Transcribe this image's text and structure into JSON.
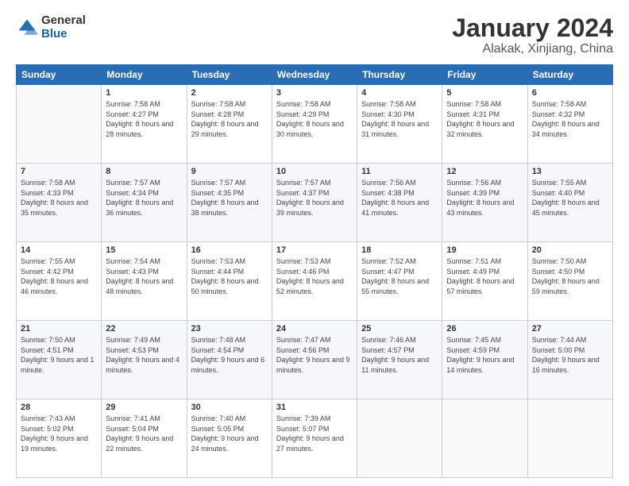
{
  "logo": {
    "general": "General",
    "blue": "Blue"
  },
  "title": "January 2024",
  "location": "Alakak, Xinjiang, China",
  "days_of_week": [
    "Sunday",
    "Monday",
    "Tuesday",
    "Wednesday",
    "Thursday",
    "Friday",
    "Saturday"
  ],
  "weeks": [
    [
      {
        "day": "",
        "sunrise": "",
        "sunset": "",
        "daylight": ""
      },
      {
        "day": "1",
        "sunrise": "Sunrise: 7:58 AM",
        "sunset": "Sunset: 4:27 PM",
        "daylight": "Daylight: 8 hours and 28 minutes."
      },
      {
        "day": "2",
        "sunrise": "Sunrise: 7:58 AM",
        "sunset": "Sunset: 4:28 PM",
        "daylight": "Daylight: 8 hours and 29 minutes."
      },
      {
        "day": "3",
        "sunrise": "Sunrise: 7:58 AM",
        "sunset": "Sunset: 4:29 PM",
        "daylight": "Daylight: 8 hours and 30 minutes."
      },
      {
        "day": "4",
        "sunrise": "Sunrise: 7:58 AM",
        "sunset": "Sunset: 4:30 PM",
        "daylight": "Daylight: 8 hours and 31 minutes."
      },
      {
        "day": "5",
        "sunrise": "Sunrise: 7:58 AM",
        "sunset": "Sunset: 4:31 PM",
        "daylight": "Daylight: 8 hours and 32 minutes."
      },
      {
        "day": "6",
        "sunrise": "Sunrise: 7:58 AM",
        "sunset": "Sunset: 4:32 PM",
        "daylight": "Daylight: 8 hours and 34 minutes."
      }
    ],
    [
      {
        "day": "7",
        "sunrise": "Sunrise: 7:58 AM",
        "sunset": "Sunset: 4:33 PM",
        "daylight": "Daylight: 8 hours and 35 minutes."
      },
      {
        "day": "8",
        "sunrise": "Sunrise: 7:57 AM",
        "sunset": "Sunset: 4:34 PM",
        "daylight": "Daylight: 8 hours and 36 minutes."
      },
      {
        "day": "9",
        "sunrise": "Sunrise: 7:57 AM",
        "sunset": "Sunset: 4:35 PM",
        "daylight": "Daylight: 8 hours and 38 minutes."
      },
      {
        "day": "10",
        "sunrise": "Sunrise: 7:57 AM",
        "sunset": "Sunset: 4:37 PM",
        "daylight": "Daylight: 8 hours and 39 minutes."
      },
      {
        "day": "11",
        "sunrise": "Sunrise: 7:56 AM",
        "sunset": "Sunset: 4:38 PM",
        "daylight": "Daylight: 8 hours and 41 minutes."
      },
      {
        "day": "12",
        "sunrise": "Sunrise: 7:56 AM",
        "sunset": "Sunset: 4:39 PM",
        "daylight": "Daylight: 8 hours and 43 minutes."
      },
      {
        "day": "13",
        "sunrise": "Sunrise: 7:55 AM",
        "sunset": "Sunset: 4:40 PM",
        "daylight": "Daylight: 8 hours and 45 minutes."
      }
    ],
    [
      {
        "day": "14",
        "sunrise": "Sunrise: 7:55 AM",
        "sunset": "Sunset: 4:42 PM",
        "daylight": "Daylight: 8 hours and 46 minutes."
      },
      {
        "day": "15",
        "sunrise": "Sunrise: 7:54 AM",
        "sunset": "Sunset: 4:43 PM",
        "daylight": "Daylight: 8 hours and 48 minutes."
      },
      {
        "day": "16",
        "sunrise": "Sunrise: 7:53 AM",
        "sunset": "Sunset: 4:44 PM",
        "daylight": "Daylight: 8 hours and 50 minutes."
      },
      {
        "day": "17",
        "sunrise": "Sunrise: 7:53 AM",
        "sunset": "Sunset: 4:46 PM",
        "daylight": "Daylight: 8 hours and 52 minutes."
      },
      {
        "day": "18",
        "sunrise": "Sunrise: 7:52 AM",
        "sunset": "Sunset: 4:47 PM",
        "daylight": "Daylight: 8 hours and 55 minutes."
      },
      {
        "day": "19",
        "sunrise": "Sunrise: 7:51 AM",
        "sunset": "Sunset: 4:49 PM",
        "daylight": "Daylight: 8 hours and 57 minutes."
      },
      {
        "day": "20",
        "sunrise": "Sunrise: 7:50 AM",
        "sunset": "Sunset: 4:50 PM",
        "daylight": "Daylight: 8 hours and 59 minutes."
      }
    ],
    [
      {
        "day": "21",
        "sunrise": "Sunrise: 7:50 AM",
        "sunset": "Sunset: 4:51 PM",
        "daylight": "Daylight: 9 hours and 1 minute."
      },
      {
        "day": "22",
        "sunrise": "Sunrise: 7:49 AM",
        "sunset": "Sunset: 4:53 PM",
        "daylight": "Daylight: 9 hours and 4 minutes."
      },
      {
        "day": "23",
        "sunrise": "Sunrise: 7:48 AM",
        "sunset": "Sunset: 4:54 PM",
        "daylight": "Daylight: 9 hours and 6 minutes."
      },
      {
        "day": "24",
        "sunrise": "Sunrise: 7:47 AM",
        "sunset": "Sunset: 4:56 PM",
        "daylight": "Daylight: 9 hours and 9 minutes."
      },
      {
        "day": "25",
        "sunrise": "Sunrise: 7:46 AM",
        "sunset": "Sunset: 4:57 PM",
        "daylight": "Daylight: 9 hours and 11 minutes."
      },
      {
        "day": "26",
        "sunrise": "Sunrise: 7:45 AM",
        "sunset": "Sunset: 4:59 PM",
        "daylight": "Daylight: 9 hours and 14 minutes."
      },
      {
        "day": "27",
        "sunrise": "Sunrise: 7:44 AM",
        "sunset": "Sunset: 5:00 PM",
        "daylight": "Daylight: 9 hours and 16 minutes."
      }
    ],
    [
      {
        "day": "28",
        "sunrise": "Sunrise: 7:43 AM",
        "sunset": "Sunset: 5:02 PM",
        "daylight": "Daylight: 9 hours and 19 minutes."
      },
      {
        "day": "29",
        "sunrise": "Sunrise: 7:41 AM",
        "sunset": "Sunset: 5:04 PM",
        "daylight": "Daylight: 9 hours and 22 minutes."
      },
      {
        "day": "30",
        "sunrise": "Sunrise: 7:40 AM",
        "sunset": "Sunset: 5:05 PM",
        "daylight": "Daylight: 9 hours and 24 minutes."
      },
      {
        "day": "31",
        "sunrise": "Sunrise: 7:39 AM",
        "sunset": "Sunset: 5:07 PM",
        "daylight": "Daylight: 9 hours and 27 minutes."
      },
      {
        "day": "",
        "sunrise": "",
        "sunset": "",
        "daylight": ""
      },
      {
        "day": "",
        "sunrise": "",
        "sunset": "",
        "daylight": ""
      },
      {
        "day": "",
        "sunrise": "",
        "sunset": "",
        "daylight": ""
      }
    ]
  ]
}
